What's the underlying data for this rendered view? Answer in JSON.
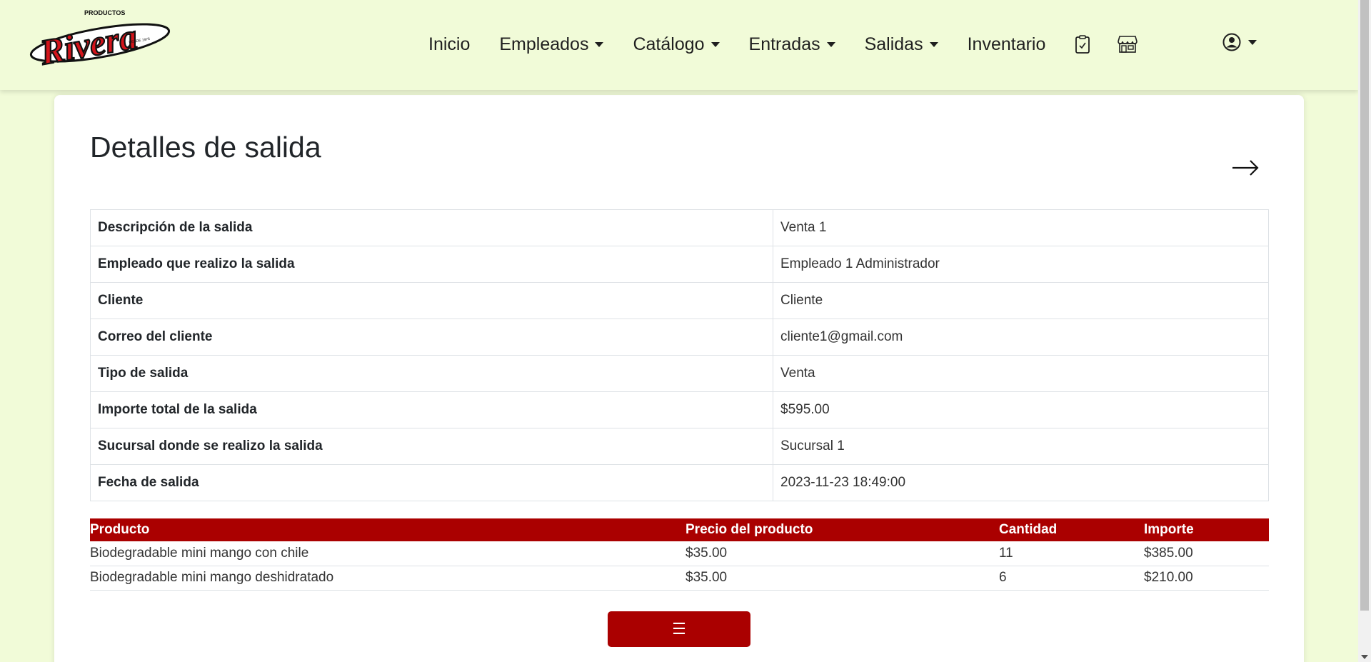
{
  "brand": {
    "top_text": "PRODUCTOS",
    "name": "Rivera",
    "tagline": "DESDE 1976"
  },
  "nav": {
    "items": [
      {
        "label": "Inicio",
        "dropdown": false
      },
      {
        "label": "Empleados",
        "dropdown": true
      },
      {
        "label": "Catálogo",
        "dropdown": true
      },
      {
        "label": "Entradas",
        "dropdown": true
      },
      {
        "label": "Salidas",
        "dropdown": true
      },
      {
        "label": "Inventario",
        "dropdown": false
      }
    ],
    "icons": [
      "clipboard-check-icon",
      "shop-icon"
    ],
    "user_icon": "user-circle-icon"
  },
  "page": {
    "title": "Detalles de salida",
    "back_icon": "arrow-right-icon"
  },
  "details": [
    {
      "label": "Descripción de la salida",
      "value": "Venta 1"
    },
    {
      "label": "Empleado que realizo la salida",
      "value": "Empleado 1 Administrador"
    },
    {
      "label": "Cliente",
      "value": "Cliente"
    },
    {
      "label": "Correo del cliente",
      "value": "cliente1@gmail.com"
    },
    {
      "label": "Tipo de salida",
      "value": "Venta"
    },
    {
      "label": "Importe total de la salida",
      "value": "$595.00"
    },
    {
      "label": "Sucursal donde se realizo la salida",
      "value": "Sucursal 1"
    },
    {
      "label": "Fecha de salida",
      "value": "2023-11-23 18:49:00"
    }
  ],
  "products": {
    "headers": [
      "Producto",
      "Precio del producto",
      "Cantidad",
      "Importe"
    ],
    "rows": [
      [
        "Biodegradable mini mango con chile",
        "$35.00",
        "11",
        "$385.00"
      ],
      [
        "Biodegradable mini mango deshidratado",
        "$35.00",
        "6",
        "$210.00"
      ]
    ]
  },
  "menu_button": {
    "label": "☰"
  },
  "colors": {
    "background": "#f1fbd8",
    "accent": "#aa0000",
    "card": "#ffffff"
  }
}
